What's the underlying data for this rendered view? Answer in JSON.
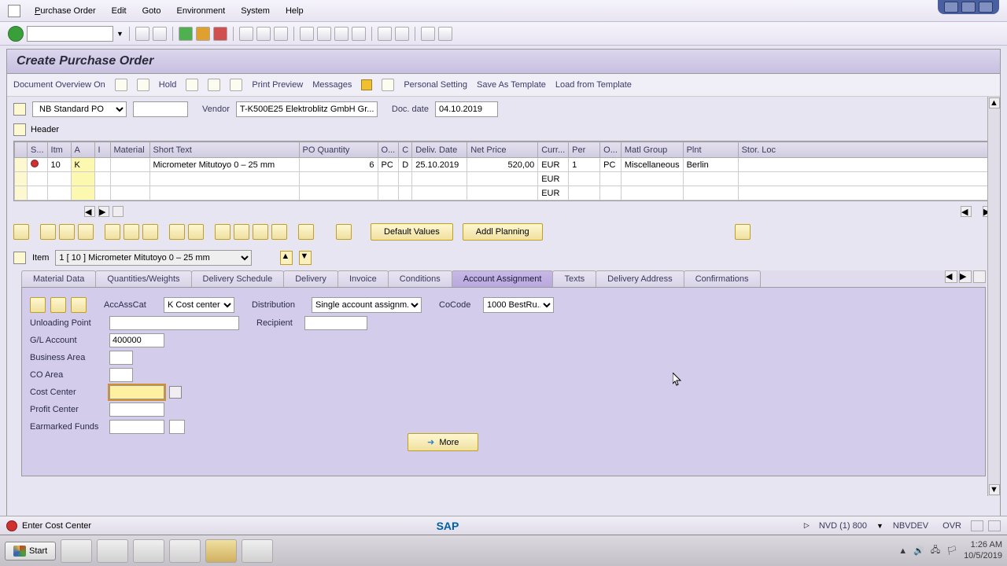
{
  "menu": {
    "po": "Purchase Order",
    "edit": "Edit",
    "goto": "Goto",
    "env": "Environment",
    "system": "System",
    "help": "Help"
  },
  "title": "Create Purchase Order",
  "actions": {
    "doc_overview": "Document Overview On",
    "hold": "Hold",
    "print_preview": "Print Preview",
    "messages": "Messages",
    "personal_setting": "Personal Setting",
    "save_template": "Save As Template",
    "load_template": "Load from Template"
  },
  "doc": {
    "type": "NB Standard PO",
    "vendor_label": "Vendor",
    "vendor": "T-K500E25 Elektroblitz GmbH Gr...",
    "docdate_label": "Doc. date",
    "docdate": "04.10.2019",
    "header_label": "Header"
  },
  "grid": {
    "cols": {
      "s": "S...",
      "itm": "Itm",
      "a": "A",
      "i": "I",
      "material": "Material",
      "short_text": "Short Text",
      "po_qty": "PO Quantity",
      "o": "O...",
      "c": "C",
      "deliv_date": "Deliv. Date",
      "net_price": "Net Price",
      "curr": "Curr...",
      "per": "Per",
      "o2": "O...",
      "matl_group": "Matl Group",
      "plnt": "Plnt",
      "stor": "Stor. Loc"
    },
    "rows": [
      {
        "itm": "10",
        "a": "K",
        "short_text": "Micrometer Mitutoyo 0 – 25 mm",
        "po_qty": "6",
        "oun": "PC",
        "c": "D",
        "deliv_date": "25.10.2019",
        "net_price": "520,00",
        "curr": "EUR",
        "per": "1",
        "o2": "PC",
        "matl_group": "Miscellaneous",
        "plnt": "Berlin"
      },
      {
        "curr": "EUR"
      },
      {
        "curr": "EUR"
      }
    ],
    "default_values": "Default Values",
    "addl_planning": "Addl Planning"
  },
  "item": {
    "label": "Item",
    "selector": "1 [ 10 ] Micrometer Mitutoyo 0 – 25 mm"
  },
  "tabs": {
    "material_data": "Material Data",
    "qty_weights": "Quantities/Weights",
    "deliv_schedule": "Delivery Schedule",
    "delivery": "Delivery",
    "invoice": "Invoice",
    "conditions": "Conditions",
    "account_assign": "Account Assignment",
    "texts": "Texts",
    "deliv_address": "Delivery Address",
    "confirmations": "Confirmations"
  },
  "aa": {
    "accasscat_label": "AccAssCat",
    "accasscat": "K Cost center",
    "distribution_label": "Distribution",
    "distribution": "Single account assignm..",
    "cocode_label": "CoCode",
    "cocode": "1000 BestRu..",
    "unloading_point": "Unloading Point",
    "recipient": "Recipient",
    "gl_account": "G/L Account",
    "gl_account_val": "400000",
    "business_area": "Business Area",
    "co_area": "CO Area",
    "cost_center": "Cost Center",
    "profit_center": "Profit Center",
    "earmarked_funds": "Earmarked Funds",
    "more": "More"
  },
  "status": {
    "msg": "Enter Cost Center",
    "sap": "SAP",
    "sys1": "NVD (1) 800",
    "sys2": "NBVDEV",
    "ovr": "OVR"
  },
  "taskbar": {
    "start": "Start",
    "time": "1:26 AM",
    "date": "10/5/2019"
  }
}
